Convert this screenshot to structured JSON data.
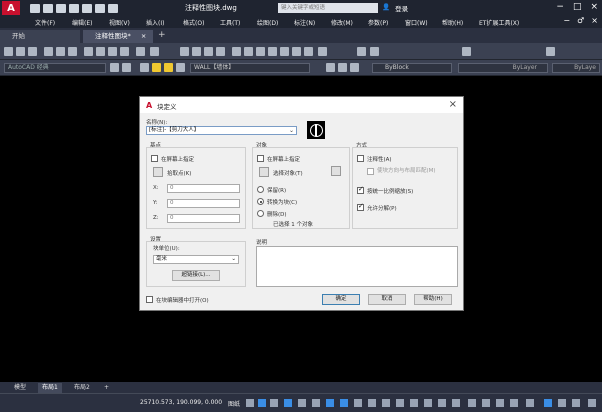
{
  "app": {
    "logo": "A",
    "document_title": "注释性图块.dwg",
    "search_placeholder": "键入关键字或短语",
    "login_label": "登录",
    "window_controls": [
      "−",
      "□",
      "×"
    ],
    "doc_controls": [
      "−",
      "♂",
      "×"
    ]
  },
  "menu": {
    "items": [
      "文件(F)",
      "编辑(E)",
      "视图(V)",
      "插入(I)",
      "格式(O)",
      "工具(T)",
      "绘图(D)",
      "标注(N)",
      "修改(M)",
      "参数(P)",
      "窗口(W)",
      "帮助(H)",
      "ET扩展工具(X)"
    ]
  },
  "tabs": {
    "start": "开始",
    "active": "注释性图块*",
    "active_close": "×",
    "add": "+"
  },
  "toolbar": {
    "workspace": "AutoCAD 经典",
    "layer": "WALL【墙体】",
    "color": "ByBlock",
    "linetype": "ByLayer",
    "lineweight": "ByLaye"
  },
  "dialog": {
    "logo": "A",
    "title": "块定义",
    "close": "×",
    "name_label": "名称(N):",
    "name_value": "[标注]-【剪刀大人】",
    "base_point": {
      "title": "基点",
      "specify_on_screen": "在屏幕上指定",
      "pick_point": "拾取点(K)",
      "x_label": "X:",
      "x_value": "0",
      "y_label": "Y:",
      "y_value": "0",
      "z_label": "Z:",
      "z_value": "0"
    },
    "objects": {
      "title": "对象",
      "specify_on_screen": "在屏幕上指定",
      "select_objects": "选择对象(T)",
      "retain": "保留(R)",
      "convert_to_block": "转换为块(C)",
      "delete": "删除(D)",
      "selected_count": "已选择 1 个对象"
    },
    "behavior": {
      "title": "方式",
      "annotative": "注释性(A)",
      "match_orientation": "使块方向与布局匹配(M)",
      "scale_uniformly": "按统一比例缩放(S)",
      "allow_exploding": "允许分解(P)"
    },
    "settings": {
      "title": "设置",
      "block_unit_label": "块单位(U):",
      "block_unit_value": "毫米",
      "hyperlink": "超链接(L)..."
    },
    "description": {
      "title": "说明"
    },
    "open_in_editor": "在块编辑器中打开(O)",
    "ok": "确定",
    "cancel": "取消",
    "help": "帮助(H)"
  },
  "model_tabs": [
    "模型",
    "布局1",
    "布局2",
    "+"
  ],
  "status": {
    "coordinates": "25710.573, 190.099, 0.000",
    "mode": "图纸"
  }
}
